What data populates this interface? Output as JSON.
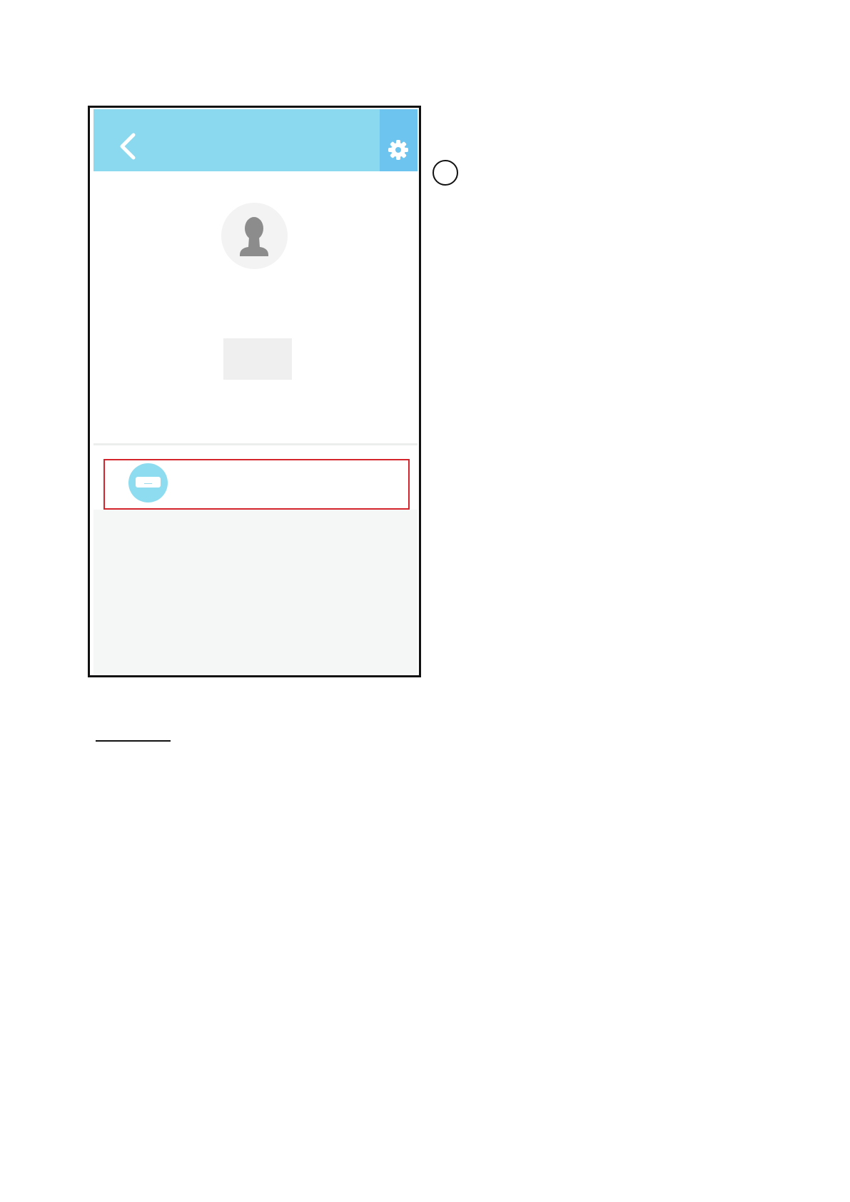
{
  "page": {
    "step_number": "",
    "note_heading": ""
  },
  "app": {
    "header": {
      "back_icon": "chevron-left-icon",
      "settings_icon": "gear-icon",
      "header_color": "#8ad9ee",
      "settings_color": "#6dc4ef"
    },
    "profile": {
      "avatar_icon": "person-silhouette-icon",
      "username": ""
    },
    "devices": [
      {
        "icon": "air-conditioner-icon",
        "name": "",
        "highlighted": true,
        "highlight_color": "#d5252c"
      }
    ]
  }
}
